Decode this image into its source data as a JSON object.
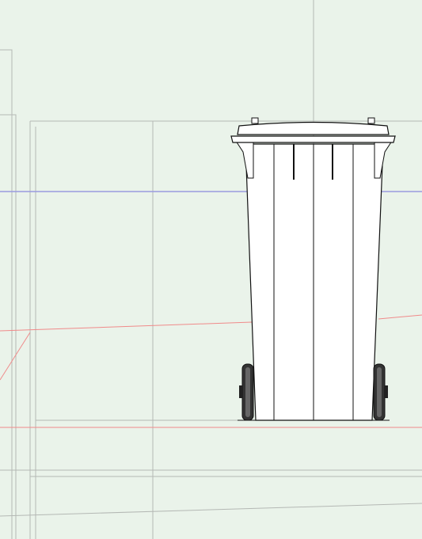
{
  "canvas": {
    "background_color": "#eaf3ea",
    "guide_line_color": "#b4b8b4",
    "highlight_line_color": "#9a9ae0",
    "red_guide_color": "#f08a8a",
    "object_outline_color": "#111111",
    "wheel_color": "#222222"
  },
  "scene": {
    "object_icon": "wheelie-bin-icon"
  }
}
